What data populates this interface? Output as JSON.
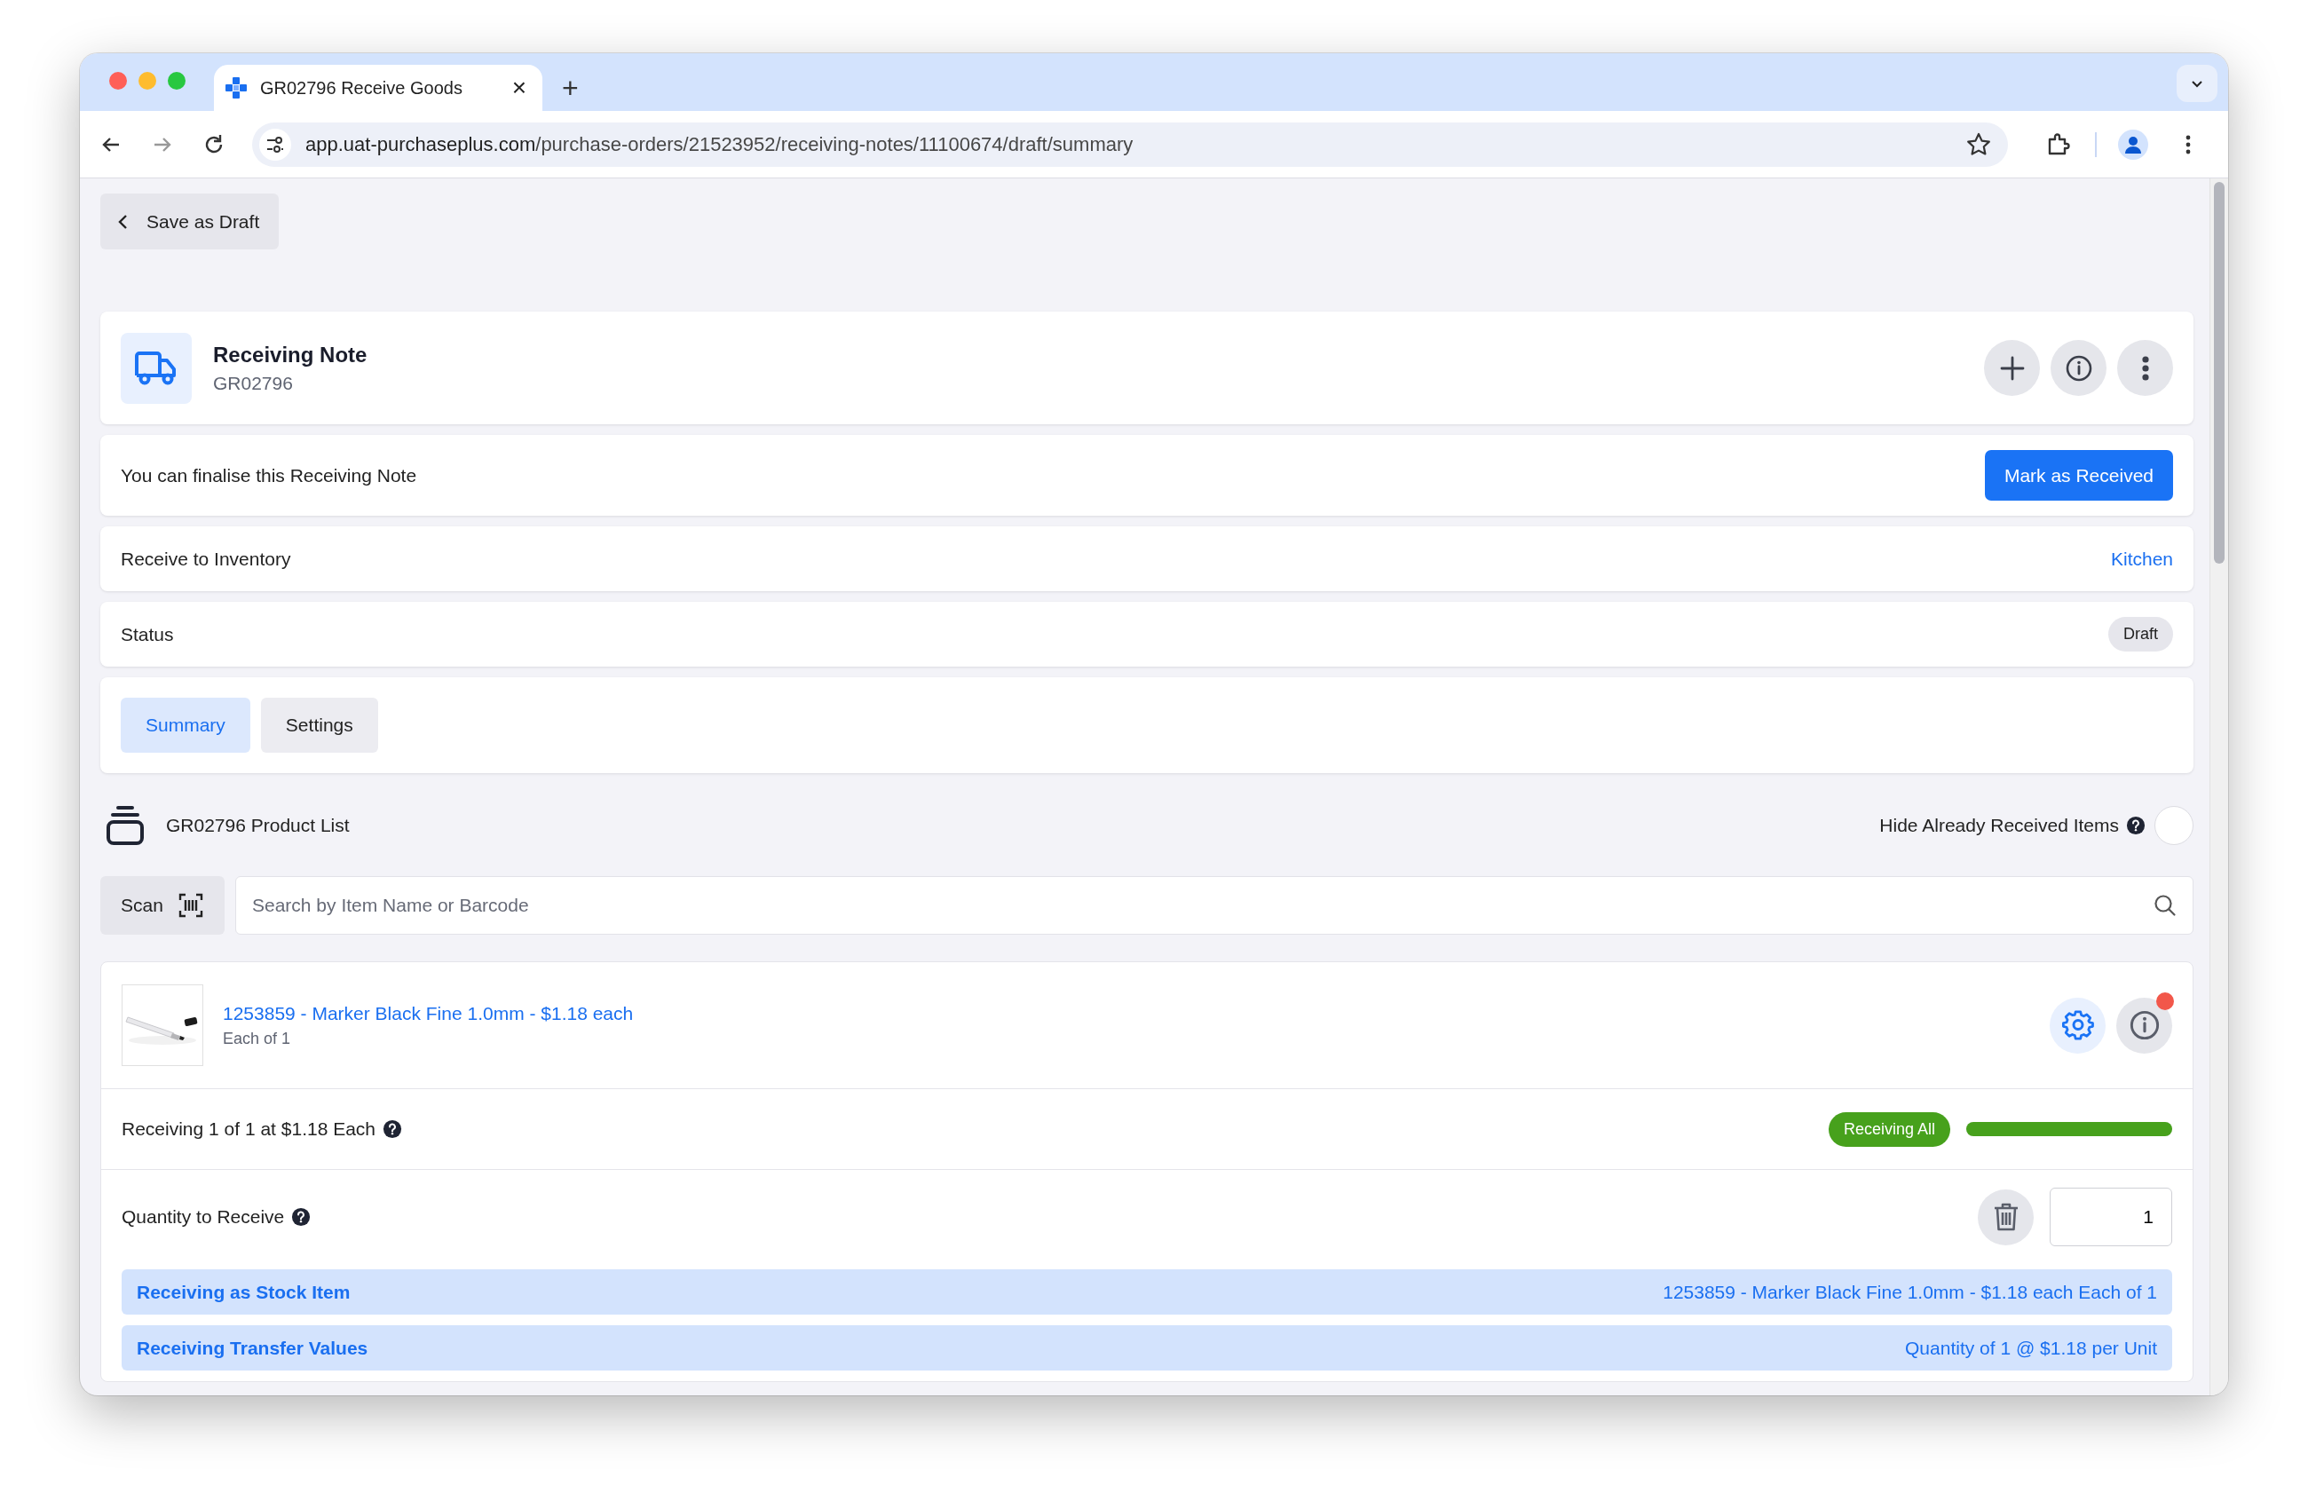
{
  "browser": {
    "tab": {
      "title": "GR02796 Receive Goods",
      "close": "×"
    },
    "new_tab": "+",
    "url_host": "app.uat-purchaseplus.com",
    "url_path": "/purchase-orders/21523952/receiving-notes/11100674/draft/summary"
  },
  "back_button": {
    "label": "Save as Draft"
  },
  "header": {
    "title": "Receiving Note",
    "subtitle": "GR02796"
  },
  "finalise": {
    "message": "You can finalise this Receiving Note",
    "button": "Mark as Received"
  },
  "inventory": {
    "label": "Receive to Inventory",
    "value": "Kitchen"
  },
  "status": {
    "label": "Status",
    "badge": "Draft"
  },
  "tabs": [
    {
      "label": "Summary",
      "selected": true
    },
    {
      "label": "Settings",
      "selected": false
    }
  ],
  "product_list": {
    "title": "GR02796 Product List",
    "hide_toggle": {
      "label": "Hide Already Received Items",
      "on": false
    }
  },
  "scan_button": {
    "label": "Scan"
  },
  "search": {
    "placeholder": "Search by Item Name or Barcode"
  },
  "products": [
    {
      "title": "1253859 - Marker Black Fine 1.0mm - $1.18 each",
      "unit": "Each of 1",
      "has_notification": true,
      "receiving_text": "Receiving 1 of 1 at $1.18 Each",
      "badge": "Receiving All",
      "level": 1,
      "quantity_label": "Quantity to Receive",
      "quantity": "1",
      "info_rows": [
        {
          "label": "Receiving as Stock Item",
          "value": "1253859 - Marker Black Fine 1.0mm - $1.18 each Each of 1"
        },
        {
          "label": "Receiving Transfer Values",
          "value": "Quantity of 1 @ $1.18 per Unit"
        }
      ]
    }
  ]
}
